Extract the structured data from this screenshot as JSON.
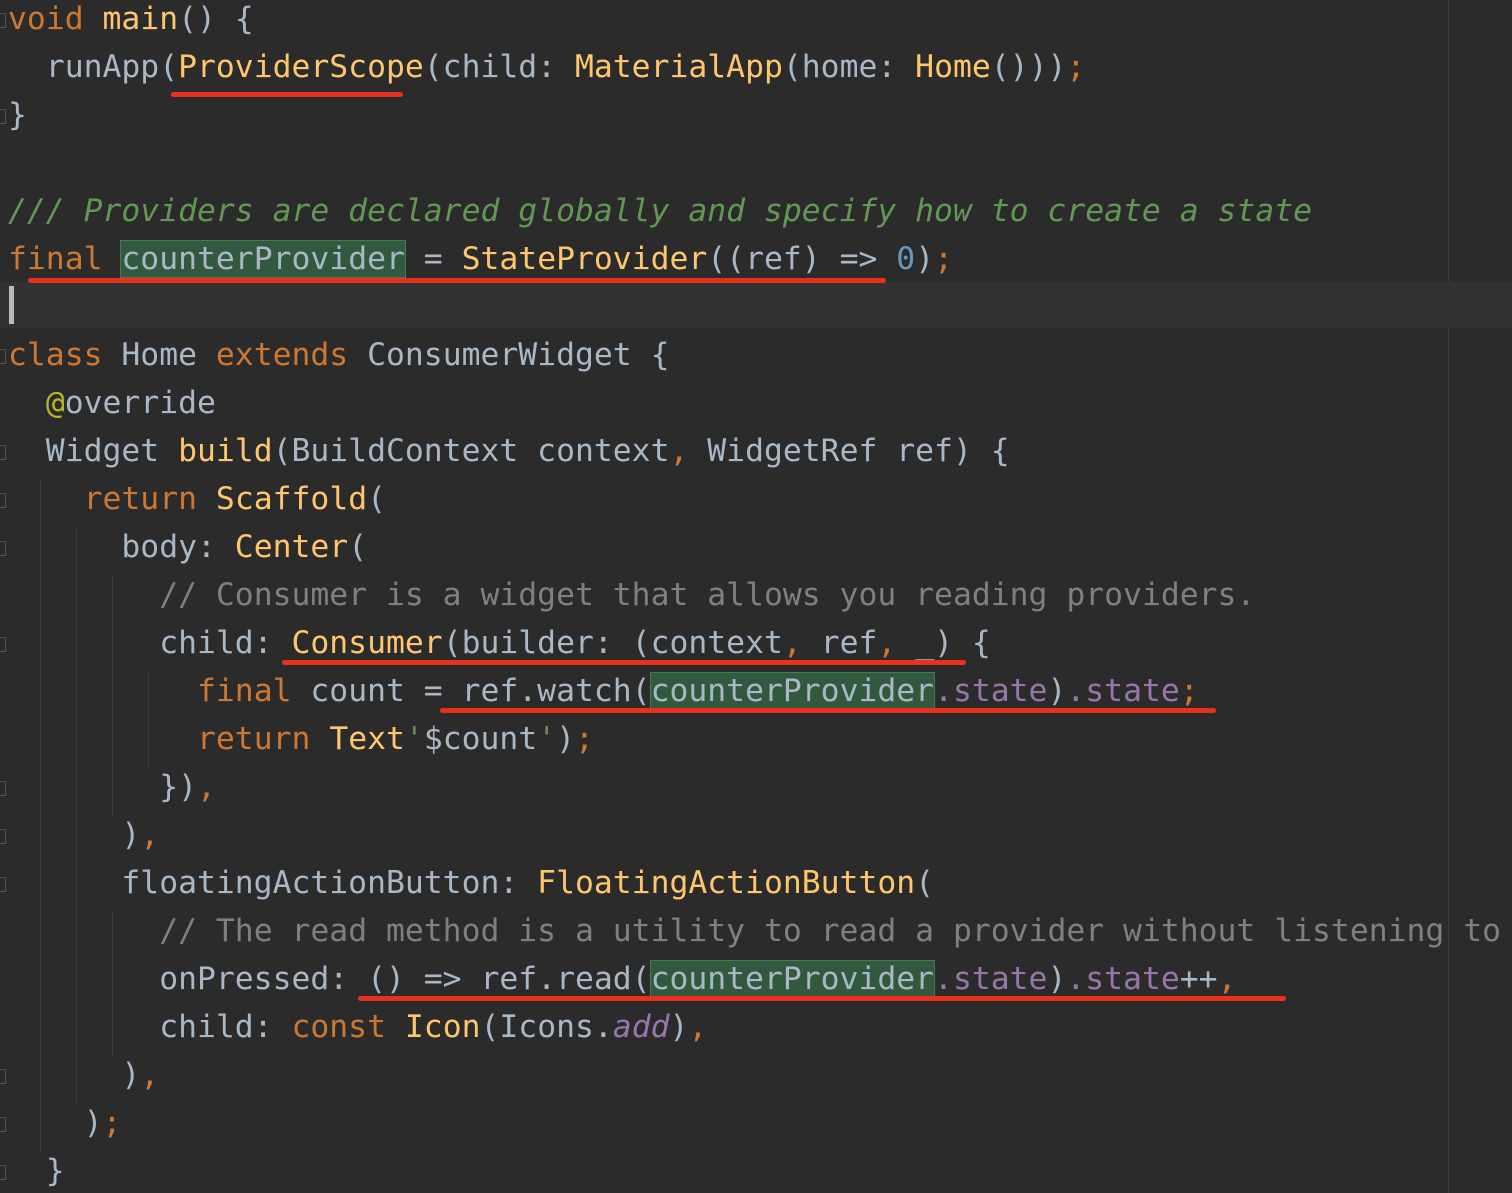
{
  "editor": {
    "language": "Dart",
    "colors": {
      "background": "#2b2b2b",
      "keyword": "#cc7832",
      "function": "#ffc66d",
      "number": "#6897bb",
      "string": "#6a8759",
      "doc_comment": "#629755",
      "comment": "#808080",
      "property": "#9876aa",
      "annotation": "#bbb529",
      "identifier_highlight": "#32593d",
      "annotation_underline": "#e8301a"
    },
    "lines": [
      [
        [
          "kw",
          "void"
        ],
        [
          "id",
          " "
        ],
        [
          "fn",
          "main"
        ],
        [
          "punc",
          "() {"
        ]
      ],
      [
        [
          "id",
          "  runApp("
        ],
        [
          "cls",
          "ProviderScope"
        ],
        [
          "punc",
          "(child: "
        ],
        [
          "cls",
          "MaterialApp"
        ],
        [
          "punc",
          "(home: "
        ],
        [
          "cls",
          "Home"
        ],
        [
          "punc",
          "()))"
        ],
        [
          "sep",
          ";"
        ]
      ],
      [
        [
          "punc",
          "}"
        ]
      ],
      [],
      [
        [
          "doc",
          "/// Providers are declared globally and specify how to create a state"
        ]
      ],
      [
        [
          "kw",
          "final"
        ],
        [
          "id",
          " "
        ],
        [
          "hl",
          "counterProvider"
        ],
        [
          "id",
          " = "
        ],
        [
          "cls",
          "StateProvider"
        ],
        [
          "punc",
          "((ref) => "
        ],
        [
          "num",
          "0"
        ],
        [
          "punc",
          ")"
        ],
        [
          "sep",
          ";"
        ]
      ],
      [],
      [
        [
          "kw",
          "class"
        ],
        [
          "id",
          " Home "
        ],
        [
          "kw",
          "extends"
        ],
        [
          "id",
          " ConsumerWidget {"
        ]
      ],
      [
        [
          "id",
          "  "
        ],
        [
          "ann",
          "@"
        ],
        [
          "id",
          "override"
        ]
      ],
      [
        [
          "id",
          "  Widget "
        ],
        [
          "fn",
          "build"
        ],
        [
          "punc",
          "(BuildContext context"
        ],
        [
          "sep",
          ","
        ],
        [
          "punc",
          " WidgetRef ref) {"
        ]
      ],
      [
        [
          "id",
          "    "
        ],
        [
          "kw",
          "return"
        ],
        [
          "id",
          " "
        ],
        [
          "cls",
          "Scaffold"
        ],
        [
          "punc",
          "("
        ]
      ],
      [
        [
          "id",
          "      body: "
        ],
        [
          "cls",
          "Center"
        ],
        [
          "punc",
          "("
        ]
      ],
      [
        [
          "id",
          "        "
        ],
        [
          "cmt",
          "// Consumer is a widget that allows you reading providers."
        ]
      ],
      [
        [
          "id",
          "        child: "
        ],
        [
          "cls",
          "Consumer"
        ],
        [
          "punc",
          "(builder: (context"
        ],
        [
          "sep",
          ","
        ],
        [
          "punc",
          " ref"
        ],
        [
          "sep",
          ","
        ],
        [
          "punc",
          " _) {"
        ]
      ],
      [
        [
          "id",
          "          "
        ],
        [
          "kw",
          "final"
        ],
        [
          "id",
          " count = ref.watch("
        ],
        [
          "hl",
          "counterProvider"
        ],
        [
          "prop",
          ".state"
        ],
        [
          "punc",
          ")"
        ],
        [
          "prop",
          ".state"
        ],
        [
          "sep",
          ";"
        ]
      ],
      [
        [
          "id",
          "          "
        ],
        [
          "kw",
          "return"
        ],
        [
          "id",
          " "
        ],
        [
          "cls",
          "Text"
        ],
        [
          "str",
          "'"
        ],
        [
          "str-ip",
          "$count"
        ],
        [
          "str",
          "'"
        ],
        [
          "punc",
          ")"
        ],
        [
          "sep",
          ";"
        ]
      ],
      [
        [
          "id",
          "        })"
        ],
        [
          "sep",
          ","
        ]
      ],
      [
        [
          "id",
          "      )"
        ],
        [
          "sep",
          ","
        ]
      ],
      [
        [
          "id",
          "      floatingActionButton: "
        ],
        [
          "cls",
          "FloatingActionButton"
        ],
        [
          "punc",
          "("
        ]
      ],
      [
        [
          "id",
          "        "
        ],
        [
          "cmt",
          "// The read method is a utility to read a provider without listening to it"
        ]
      ],
      [
        [
          "id",
          "        onPressed: () => ref.read("
        ],
        [
          "hl",
          "counterProvider"
        ],
        [
          "prop",
          ".state"
        ],
        [
          "punc",
          ")"
        ],
        [
          "prop",
          ".state"
        ],
        [
          "punc",
          "++"
        ],
        [
          "sep",
          ","
        ]
      ],
      [
        [
          "id",
          "        child: "
        ],
        [
          "kw",
          "const"
        ],
        [
          "id",
          " "
        ],
        [
          "cls",
          "Icon"
        ],
        [
          "punc",
          "(Icons."
        ],
        [
          "static",
          "add"
        ],
        [
          "punc",
          ")"
        ],
        [
          "sep",
          ","
        ]
      ],
      [
        [
          "id",
          "      )"
        ],
        [
          "sep",
          ","
        ]
      ],
      [
        [
          "id",
          "    )"
        ],
        [
          "sep",
          ";"
        ]
      ],
      [
        [
          "id",
          "  }"
        ]
      ]
    ]
  }
}
